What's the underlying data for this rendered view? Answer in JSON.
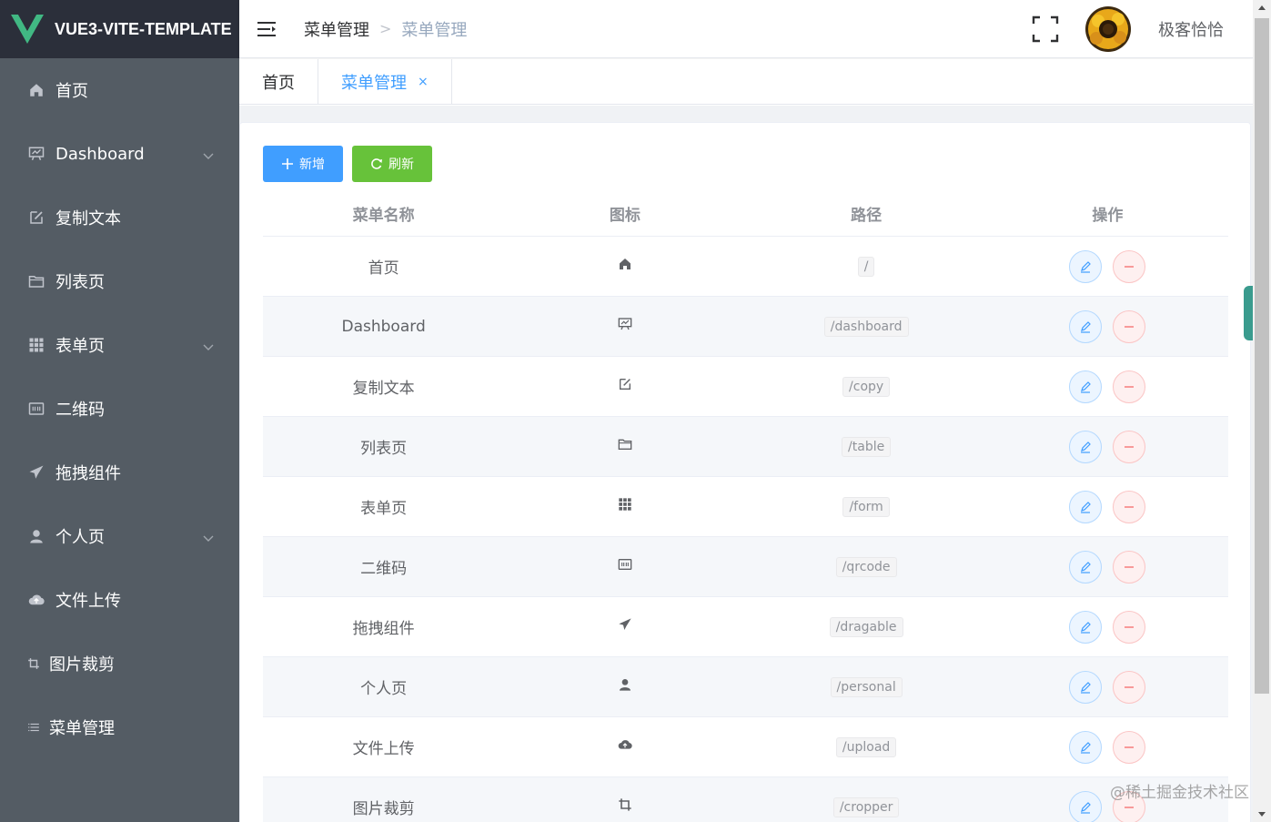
{
  "brand": {
    "title": "VUE3-VITE-TEMPLATE"
  },
  "sidebar": {
    "items": [
      {
        "label": "首页",
        "icon": "home-icon"
      },
      {
        "label": "Dashboard",
        "icon": "dashboard-icon",
        "has_children": true
      },
      {
        "label": "复制文本",
        "icon": "edit-icon"
      },
      {
        "label": "列表页",
        "icon": "folder-icon"
      },
      {
        "label": "表单页",
        "icon": "grid-icon",
        "has_children": true
      },
      {
        "label": "二维码",
        "icon": "qrcode-icon"
      },
      {
        "label": "拖拽组件",
        "icon": "send-icon"
      },
      {
        "label": "个人页",
        "icon": "user-icon",
        "has_children": true
      },
      {
        "label": "文件上传",
        "icon": "upload-icon"
      },
      {
        "label": "图片裁剪",
        "icon": "crop-icon"
      },
      {
        "label": "菜单管理",
        "icon": "menu-icon"
      }
    ]
  },
  "header": {
    "breadcrumb": [
      "菜单管理",
      "菜单管理"
    ],
    "breadcrumb_separator": ">",
    "username": "极客恰恰"
  },
  "tags": {
    "items": [
      {
        "label": "首页"
      },
      {
        "label": "菜单管理",
        "closable": "×"
      }
    ]
  },
  "toolbar": {
    "add_label": "新增",
    "refresh_label": "刷新"
  },
  "table": {
    "columns": [
      "菜单名称",
      "图标",
      "路径",
      "操作"
    ],
    "rows": [
      {
        "name": "首页",
        "icon": "home-icon",
        "path": "/"
      },
      {
        "name": "Dashboard",
        "icon": "dashboard-icon",
        "path": "/dashboard"
      },
      {
        "name": "复制文本",
        "icon": "edit-icon",
        "path": "/copy"
      },
      {
        "name": "列表页",
        "icon": "folder-icon",
        "path": "/table"
      },
      {
        "name": "表单页",
        "icon": "grid-icon",
        "path": "/form"
      },
      {
        "name": "二维码",
        "icon": "qrcode-icon",
        "path": "/qrcode"
      },
      {
        "name": "拖拽组件",
        "icon": "send-icon",
        "path": "/dragable"
      },
      {
        "name": "个人页",
        "icon": "user-icon",
        "path": "/personal"
      },
      {
        "name": "文件上传",
        "icon": "upload-icon",
        "path": "/upload"
      },
      {
        "name": "图片裁剪",
        "icon": "crop-icon",
        "path": "/cropper"
      }
    ]
  },
  "watermark": "@稀土掘金技术社区",
  "colors": {
    "sidebar_bg": "#545c64",
    "logo_bg": "#2b2f3a",
    "primary": "#409eff",
    "success": "#67c23a",
    "danger": "#f56c6c",
    "accent_handle": "#3a9b8e"
  }
}
